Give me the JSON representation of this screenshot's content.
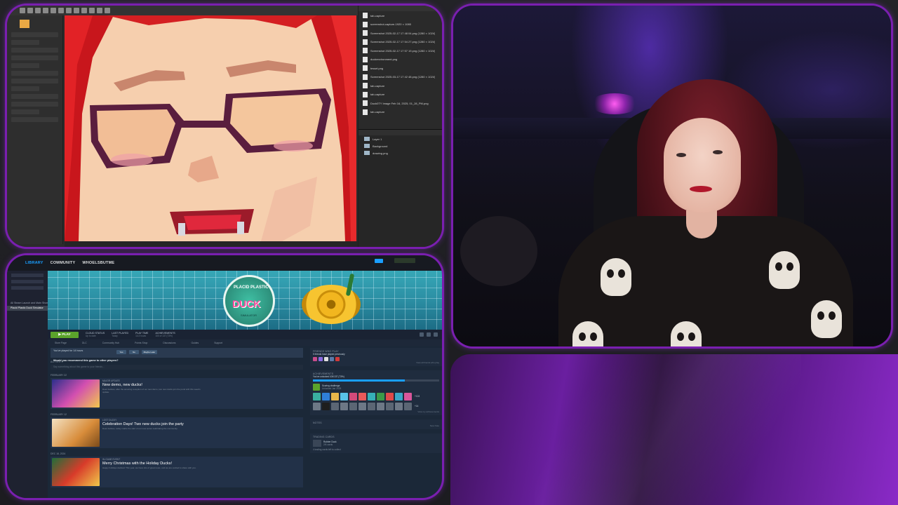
{
  "editor": {
    "files": [
      "tab-capture",
      "screenshot-capture-1920 × 1080",
      "Screenshot 2025-02-17 17 48 04.png (1280 × 1024)",
      "Screenshot 2025-02-17 17 54 27.png (1280 × 1024)",
      "Screenshot 2025-02-17 17 57 19.png (1280 × 1024)",
      "duckenvironment.png",
      "tessel.png",
      "Screenshot 2025-03-17 17 42 48.png (1280 × 1024)",
      "tab-capture",
      "tab-capture",
      "Duck0TY Image Feb 16, 2025, 01_28_PM.png",
      "tab-capture"
    ],
    "layers": [
      "Layer 1",
      "Background",
      "drawing.png"
    ]
  },
  "steam": {
    "tabs": {
      "library": "LIBRARY",
      "community": "COMMUNITY",
      "user": "WHOELSBUTME"
    },
    "sidebar": {
      "items": [
        "All Steam Launch and Main Shows",
        "Placid Plastic Duck Simulator"
      ],
      "selected_index": 1
    },
    "hero": {
      "logo_line1": "PLACID PLASTIC",
      "logo_line2": "DUCK",
      "logo_line3": "SIMULATOR"
    },
    "actionbar": {
      "play_label": "PLAY",
      "stats": [
        {
          "k": "CLOUD STATUS",
          "v": "Up to date"
        },
        {
          "k": "LAST PLAYED",
          "v": "Today"
        },
        {
          "k": "PLAY TIME",
          "v": "14.3 hours"
        },
        {
          "k": "ACHIEVEMENTS",
          "v": "100 of 137 (73%)"
        }
      ]
    },
    "subnav": [
      "Store Page",
      "DLC",
      "Community Hub",
      "Points Shop",
      "Discussions",
      "Guides",
      "Support"
    ],
    "recommend": {
      "line1": "You've played for 14 hours",
      "line2": "Would you recommend this game to other players?",
      "yes": "Yes",
      "no": "No",
      "later": "Maybe Later"
    },
    "activity_label": "ACTIVITY",
    "activity_placeholder": "Say something about this game to your friends...",
    "feed": [
      {
        "date": "FEBRUARY 22",
        "type": "MAJOR UPDATE",
        "title": "New demo, new ducks!",
        "desc": "Dear duckies, after the amazing reception of our new demo, two new ducks join the pond with this week's update."
      },
      {
        "date": "FEBRUARY 12",
        "type": "LOST DUCKY",
        "title": "Celebration Days! Two new ducks join the party",
        "desc": "Dear duckies, today marks the start of our new series celebrating the community."
      },
      {
        "date": "DEC 18, 2024",
        "type": "IN-GAME EVENT",
        "title": "Merry Christmas with the Holiday Ducks!",
        "desc": "Happy holidays duckies! This year, we have lots of great news, and we are excited to share with you."
      }
    ],
    "right": {
      "friends_title": "FRIENDS WHO PLAY",
      "friends_text": "5 friends have played previously",
      "friends_link": "View all friends who play",
      "ach_title": "ACHIEVEMENTS",
      "ach_text": "You've unlocked 100/137 (73%)",
      "ach_item_title": "Scoring challenge",
      "ach_item_sub": "Unlocked Jan 2025",
      "ach_more": "+124",
      "ach_locked_more": "+14",
      "ach_link": "View my achievements",
      "notes_title": "NOTES",
      "notes_link": "New Note",
      "trading_title": "TRADING CARDS",
      "trading_sub": "Rubber Duck",
      "trading_val": "2/6 cards",
      "trading_text": "4 trading cards left to collect",
      "ach_progress": 0.73
    },
    "colors": {
      "accent": "#1a9fff",
      "play": "#5ba32b",
      "bg": "#1b2838"
    }
  },
  "overlay": {
    "accent": "#8e2bd0"
  }
}
